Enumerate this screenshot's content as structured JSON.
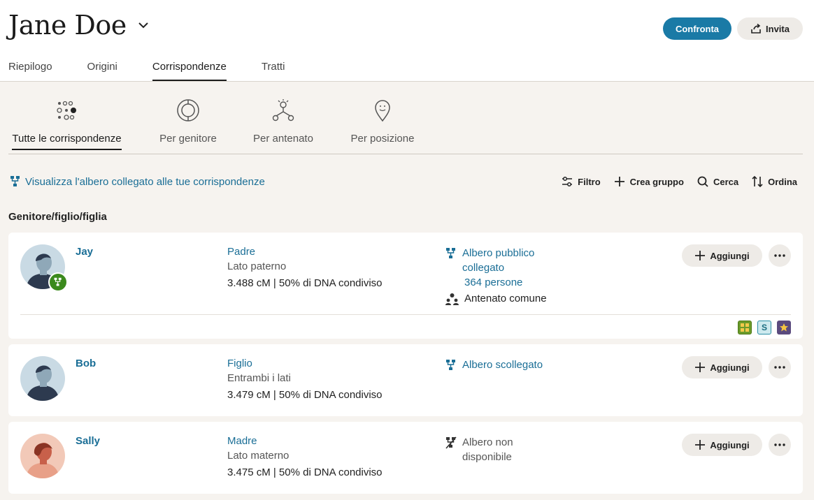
{
  "header": {
    "name": "Jane Doe",
    "compare_label": "Confronta",
    "invite_label": "Invita",
    "tabs": [
      {
        "label": "Riepilogo",
        "active": false
      },
      {
        "label": "Origini",
        "active": false
      },
      {
        "label": "Corrispondenze",
        "active": true
      },
      {
        "label": "Tratti",
        "active": false
      }
    ]
  },
  "subnav": [
    {
      "label": "Tutte le corrispondenze",
      "icon": "all-matches-icon",
      "active": true
    },
    {
      "label": "Per genitore",
      "icon": "parent-icon",
      "active": false
    },
    {
      "label": "Per antenato",
      "icon": "ancestor-icon",
      "active": false
    },
    {
      "label": "Per posizione",
      "icon": "location-pin-icon",
      "active": false
    }
  ],
  "toolbar": {
    "tree_link": "Visualizza l'albero collegato alle tue corrispondenze",
    "filter": "Filtro",
    "create_group": "Crea gruppo",
    "search": "Cerca",
    "sort": "Ordina"
  },
  "section_title": "Genitore/figlio/figlia",
  "matches": [
    {
      "name": "Jay",
      "relationship": "Padre",
      "side": "Lato paterno",
      "dna": "3.488 cM | 50% di DNA condiviso",
      "tree_status": "Albero pubblico collegato",
      "tree_people": "364 persone",
      "common_ancestor": "Antenato comune",
      "add_label": "Aggiungi",
      "badges": [
        "group-badge",
        "S",
        "star-badge"
      ],
      "badge_text": "S"
    },
    {
      "name": "Bob",
      "relationship": "Figlio",
      "side": "Entrambi i lati",
      "dna": "3.479 cM | 50% di DNA condiviso",
      "tree_status": "Albero scollegato",
      "add_label": "Aggiungi"
    },
    {
      "name": "Sally",
      "relationship": "Madre",
      "side": "Lato materno",
      "dna": "3.475 cM | 50% di DNA condiviso",
      "tree_status": "Albero non disponibile",
      "add_label": "Aggiungi"
    }
  ],
  "colors": {
    "accent": "#1a7aa6",
    "link": "#1a6e96",
    "background": "#f6f3ef",
    "tree_badge": "#3b8a1d"
  }
}
